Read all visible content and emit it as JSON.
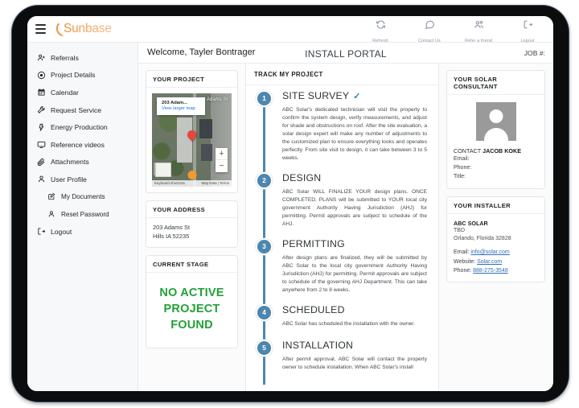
{
  "topbar": {
    "menu_icon": "hamburger-icon",
    "logo_text": "Sunbase",
    "actions": [
      {
        "icon": "refresh-icon",
        "label": "Refresh"
      },
      {
        "icon": "chat-icon",
        "label": "Contact Us"
      },
      {
        "icon": "people-icon",
        "label": "Refer a friend"
      },
      {
        "icon": "logout-icon",
        "label": "Logout"
      }
    ]
  },
  "sidebar": {
    "items": [
      {
        "icon": "user-plus-icon",
        "label": "Referrals",
        "sub": false
      },
      {
        "icon": "target-icon",
        "label": "Project Details",
        "sub": false
      },
      {
        "icon": "calendar-icon",
        "label": "Calendar",
        "sub": false
      },
      {
        "icon": "wrench-icon",
        "label": "Request Service",
        "sub": false
      },
      {
        "icon": "bolt-icon",
        "label": "Energy Production",
        "sub": false
      },
      {
        "icon": "monitor-icon",
        "label": "Reference videos",
        "sub": false
      },
      {
        "icon": "paperclip-icon",
        "label": "Attachments",
        "sub": false
      },
      {
        "icon": "user-icon",
        "label": "User Profile",
        "sub": false
      },
      {
        "icon": "document-icon",
        "label": "My Documents",
        "sub": true
      },
      {
        "icon": "user-icon",
        "label": "Reset Password",
        "sub": true
      },
      {
        "icon": "logout-icon",
        "label": "Logout",
        "sub": false
      }
    ]
  },
  "header": {
    "welcome": "Welcome, Tayler Bontrager",
    "portal_title": "INSTALL PORTAL",
    "job_label": "JOB #:"
  },
  "project_card": {
    "title": "YOUR PROJECT",
    "map": {
      "info_title": "203 Adam...",
      "info_link": "View larger map",
      "street_label": "Adams St",
      "zoom_in": "+",
      "zoom_out": "−",
      "footer_left": "Keyboard shortcuts",
      "footer_right": "Map Data | Terms"
    }
  },
  "address_card": {
    "title": "YOUR ADDRESS",
    "line1": "203 Adams St",
    "line2": "Hills IA 52235"
  },
  "stage_card": {
    "title": "CURRENT STAGE",
    "status": "NO ACTIVE PROJECT FOUND",
    "status_color": "#22a03a"
  },
  "track": {
    "title": "TRACK MY PROJECT",
    "accent_color": "#4d86ae",
    "steps": [
      {
        "number": "1",
        "title": "SITE SURVEY",
        "completed": true,
        "check": "✓",
        "desc": "ABC Solar's dedicated technician will visit the property to confirm the system design, verify measurements, and adjust for shade and obstructions on roof. After the site evaluation, a solar design expert will make any number of adjustments to the customized plan to ensure everything looks and operates perfectly. From site visit to design, it can take between 3 to 5 weeks."
      },
      {
        "number": "2",
        "title": "DESIGN",
        "completed": false,
        "check": "",
        "desc": "ABC Solar WILL FINALIZE YOUR design plans. ONCE COMPLETED, PLANS will be submitted to YOUR local city government Authority Having Jurisdiction (AHJ) for permitting. Permit approvals are subject to schedule of the AHJ."
      },
      {
        "number": "3",
        "title": "PERMITTING",
        "completed": false,
        "check": "",
        "desc": "After design plans are finalized, they will be submitted by ABC Solar to the local city government Authority Having Jurisdiction (AHJ) for permitting. Permit approvals are subject to schedule of the governing AHJ Department. This can take anywhere from 2 to 8 weeks."
      },
      {
        "number": "4",
        "title": "SCHEDULED",
        "completed": false,
        "check": "",
        "desc": "ABC Solar has scheduled the installation with the owner."
      },
      {
        "number": "5",
        "title": "INSTALLATION",
        "completed": false,
        "check": "",
        "desc": "After permit approval, ABC Solar will contact the property owner to schedule installation. When ABC Solar's install"
      }
    ]
  },
  "consultant_card": {
    "title": "YOUR SOLAR CONSULTANT",
    "avatar_icon": "person-avatar-icon",
    "contact_prefix": "CONTACT",
    "contact_name": "JACOB KOKE",
    "fields": [
      {
        "label": "Email:",
        "value": ""
      },
      {
        "label": "Phone:",
        "value": ""
      },
      {
        "label": "Title:",
        "value": ""
      }
    ]
  },
  "installer_card": {
    "title": "YOUR INSTALLER",
    "company": "ABC SOLAR",
    "line2": "TBD",
    "line3": "Orlando, Florida 32828",
    "email_label": "Email:",
    "email_value": "info@solar.com",
    "website_label": "Website:",
    "website_value": "Solar.com",
    "phone_label": "Phone:",
    "phone_value": "888-275-3548"
  }
}
